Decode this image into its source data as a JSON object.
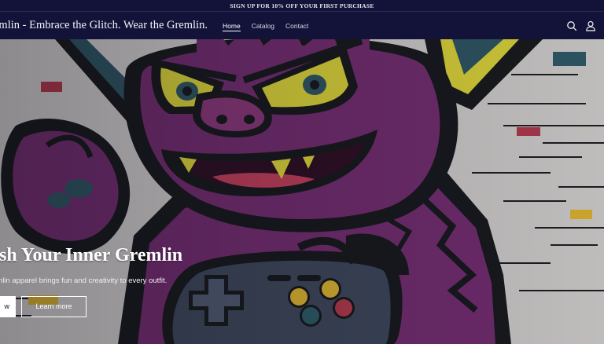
{
  "announcement": {
    "text": "SIGN UP FOR 10% OFF YOUR FIRST PURCHASE"
  },
  "header": {
    "brand": "emlin - Embrace the Glitch. Wear the Gremlin.",
    "nav": [
      {
        "label": "Home",
        "active": true
      },
      {
        "label": "Catalog",
        "active": false
      },
      {
        "label": "Contact",
        "active": false
      }
    ],
    "icons": [
      "search-icon",
      "account-icon"
    ]
  },
  "hero": {
    "title": "ash Your Inner Gremlin",
    "subtitle": "emlin apparel brings fun and creativity to every outfit.",
    "primary_button": "w",
    "secondary_button": "Learn more"
  },
  "colors": {
    "header_bg": "#13133a",
    "hero_bg": "#bfbcbc",
    "gremlin_purple": "#6a2a68",
    "eye_yellow": "#c9c236",
    "outline": "#16181c"
  }
}
